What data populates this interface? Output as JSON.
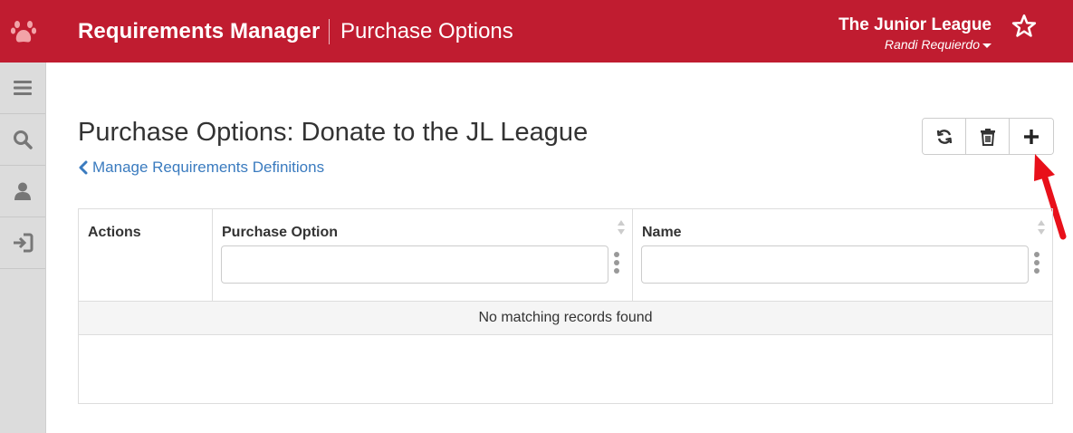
{
  "header": {
    "logo_icon": "paw-icon",
    "app_title": "Requirements Manager",
    "section_title": "Purchase Options",
    "org_name": "The Junior League",
    "user_name": "Randi Requierdo",
    "favorite_icon": "star-icon",
    "brand_color": "#c01c30"
  },
  "sidebar": {
    "items": [
      {
        "icon": "menu-icon"
      },
      {
        "icon": "search-icon"
      },
      {
        "icon": "user-icon"
      },
      {
        "icon": "logout-icon"
      }
    ]
  },
  "main": {
    "title": "Purchase Options: Donate to the JL League",
    "back_link": "Manage Requirements Definitions",
    "toolbar": {
      "buttons": [
        {
          "icon": "refresh-icon"
        },
        {
          "icon": "trash-icon"
        },
        {
          "icon": "plus-icon"
        }
      ]
    },
    "annotation_arrow_color": "#e8101a",
    "table": {
      "columns": [
        {
          "label": "Actions"
        },
        {
          "label": "Purchase Option",
          "filter_value": "",
          "filter_placeholder": ""
        },
        {
          "label": "Name",
          "filter_value": "",
          "filter_placeholder": ""
        }
      ],
      "empty_message": "No matching records found"
    }
  }
}
